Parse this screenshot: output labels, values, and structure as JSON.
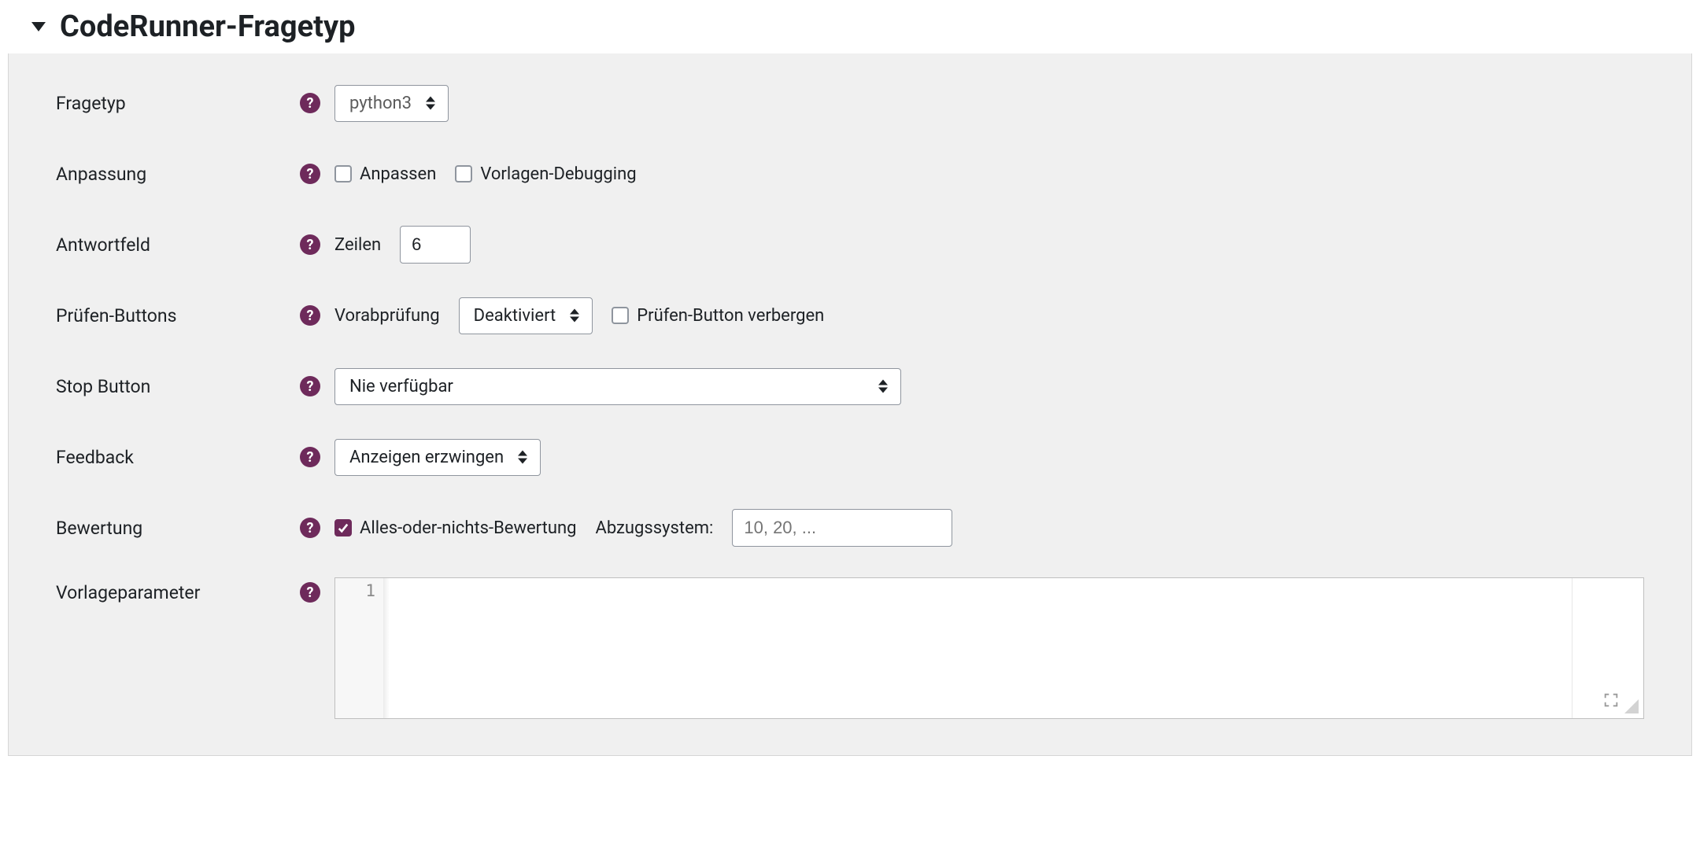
{
  "section": {
    "title": "CodeRunner-Fragetyp"
  },
  "rows": {
    "fragetyp": {
      "label": "Fragetyp",
      "select_value": "python3"
    },
    "anpassung": {
      "label": "Anpassung",
      "checkbox_anpassen": "Anpassen",
      "checkbox_debugging": "Vorlagen-Debugging"
    },
    "antwortfeld": {
      "label": "Antwortfeld",
      "zeilen_label": "Zeilen",
      "zeilen_value": "6"
    },
    "pruefen": {
      "label": "Prüfen-Buttons",
      "vorab_label": "Vorabprüfung",
      "vorab_value": "Deaktiviert",
      "hide_checkbox": "Prüfen-Button verbergen"
    },
    "stop": {
      "label": "Stop Button",
      "value": "Nie verfügbar"
    },
    "feedback": {
      "label": "Feedback",
      "value": "Anzeigen erzwingen"
    },
    "bewertung": {
      "label": "Bewertung",
      "checkbox_label": "Alles-oder-nichts-Bewertung",
      "checkbox_checked": true,
      "abzug_label": "Abzugssystem:",
      "abzug_placeholder": "10, 20, ..."
    },
    "vorlageparameter": {
      "label": "Vorlageparameter",
      "line_no": "1"
    }
  }
}
